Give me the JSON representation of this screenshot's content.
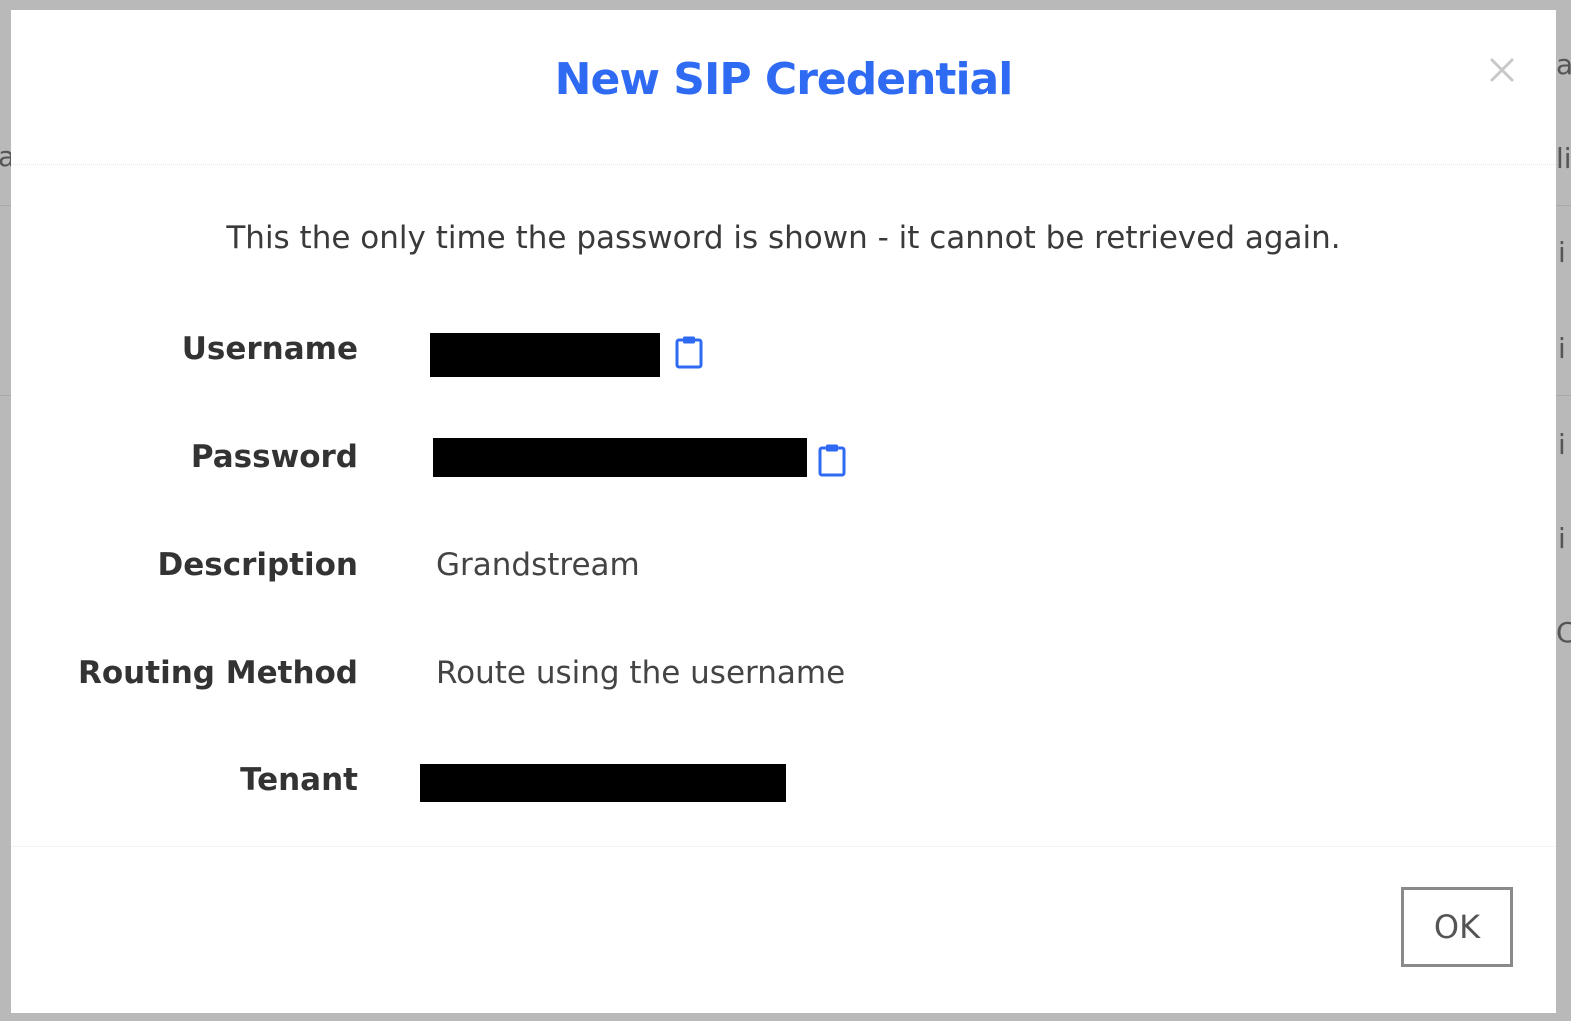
{
  "background": {
    "fragments": [
      "a",
      "a",
      "li",
      "i",
      "i",
      "i",
      "i",
      "C"
    ]
  },
  "dialog": {
    "title": "New SIP Credential",
    "close_icon": "close-icon",
    "notice": "This the only time the password is shown - it cannot be retrieved again.",
    "fields": {
      "username_label": "Username",
      "password_label": "Password",
      "description_label": "Description",
      "description_value": "Grandstream",
      "routing_label": "Routing Method",
      "routing_value": "Route using the username",
      "tenant_label": "Tenant"
    },
    "copy_icon": "clipboard-icon",
    "ok_label": "OK"
  },
  "colors": {
    "title": "#2f6af3",
    "icon": "#2f6af3",
    "overlay": "#b9b9b9",
    "redaction": "#000000"
  }
}
